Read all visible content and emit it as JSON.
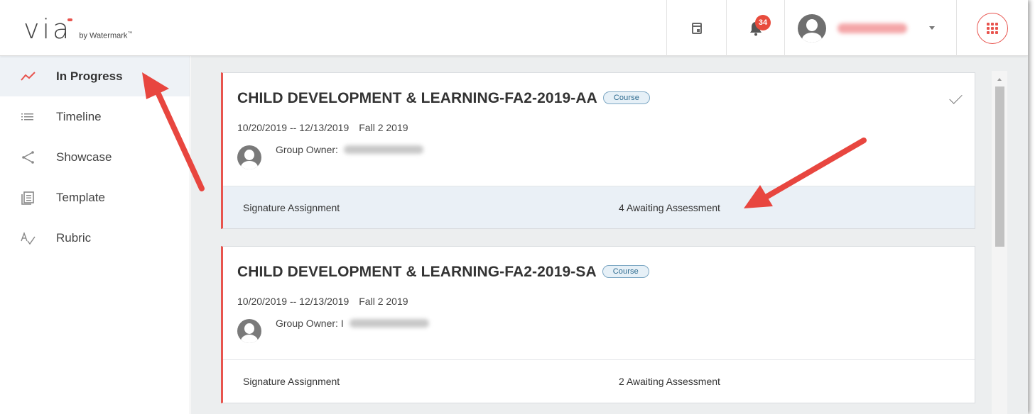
{
  "brand": {
    "logo_word": "via",
    "logo_by": "by Watermark",
    "logo_tm": "™"
  },
  "header": {
    "notification_count": "34",
    "icons": [
      "calendar-icon",
      "bell-icon",
      "user-avatar",
      "caret-down-icon",
      "apps-grid-icon"
    ]
  },
  "sidebar": {
    "items": [
      {
        "label": "In Progress",
        "icon": "trend-line-icon",
        "active": true
      },
      {
        "label": "Timeline",
        "icon": "list-icon",
        "active": false
      },
      {
        "label": "Showcase",
        "icon": "share-icon",
        "active": false
      },
      {
        "label": "Template",
        "icon": "template-icon",
        "active": false
      },
      {
        "label": "Rubric",
        "icon": "rubric-icon",
        "active": false
      }
    ]
  },
  "cards": [
    {
      "title": "CHILD DEVELOPMENT & LEARNING-FA2-2019-AA",
      "badge": "Course",
      "dates": "10/20/2019 -- 12/13/2019",
      "term": "Fall 2 2019",
      "owner_label": "Group Owner:",
      "assignment": "Signature Assignment",
      "awaiting": "4 Awaiting Assessment"
    },
    {
      "title": "CHILD DEVELOPMENT & LEARNING-FA2-2019-SA",
      "badge": "Course",
      "dates": "10/20/2019 -- 12/13/2019",
      "term": "Fall 2 2019",
      "owner_label": "Group Owner: I",
      "assignment": "Signature Assignment",
      "awaiting": "2 Awaiting Assessment"
    }
  ],
  "colors": {
    "accent": "#e8544e",
    "annotation_arrow": "#e8463f",
    "badge_border": "#7ea8c4"
  }
}
